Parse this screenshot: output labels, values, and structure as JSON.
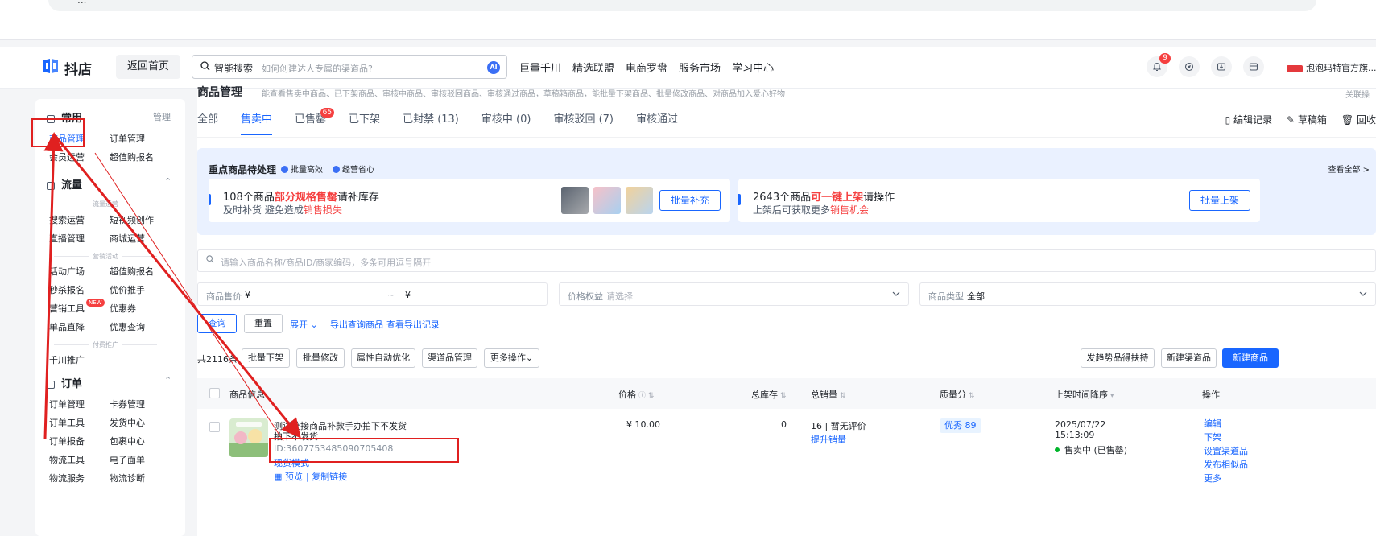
{
  "browser": {
    "url": "..."
  },
  "header": {
    "logo_text": "抖店",
    "home_button": "返回首页",
    "search_label": "智能搜索",
    "search_placeholder": "如何创建达人专属的渠道品?",
    "search_ai": "AI",
    "nav": [
      "巨量千川",
      "精选联盟",
      "电商罗盘",
      "服务市场",
      "学习中心"
    ],
    "notification_count": "9",
    "shop_name": "泡泡玛特官方旗..."
  },
  "sidebar": {
    "common": {
      "title": "常用",
      "manage": "管理",
      "items": [
        "商品管理",
        "订单管理",
        "会员运营",
        "超值购报名"
      ]
    },
    "traffic": {
      "title": "流量",
      "group1": "流量运营",
      "group1_items": [
        "搜索运营",
        "短视频创作",
        "直播管理",
        "商城运营"
      ],
      "group2": "营销活动",
      "group2_items": [
        "活动广场",
        "超值购报名",
        "秒杀报名",
        "优价推手",
        "营销工具",
        "优惠券",
        "单品直降",
        "优惠查询"
      ],
      "new_badge": "NEW",
      "group3": "付费推广",
      "group3_items": [
        "千川推广"
      ]
    },
    "orders": {
      "title": "订单",
      "items": [
        "订单管理",
        "卡券管理",
        "订单工具",
        "发货中心",
        "订单报备",
        "包裹中心",
        "物流工具",
        "电子面单",
        "物流服务",
        "物流诊断"
      ]
    }
  },
  "main": {
    "title": "商品管理",
    "description": "能查看售卖中商品、已下架商品、审核中商品、审核驳回商品、审核通过商品，草稿箱商品，能批量下架商品、批量修改商品、对商品加入爱心好物",
    "top_right": "关联操",
    "tabs": [
      {
        "label": "全部"
      },
      {
        "label": "售卖中",
        "active": true
      },
      {
        "label": "已售罄",
        "badge": "65"
      },
      {
        "label": "已下架"
      },
      {
        "label": "已封禁 (13)"
      },
      {
        "label": "审核中 (0)"
      },
      {
        "label": "审核驳回 (7)"
      },
      {
        "label": "审核通过"
      }
    ],
    "tab_tools": [
      "编辑记录",
      "草稿箱",
      "回收"
    ],
    "focus": {
      "title": "重点商品待处理",
      "chip1": "批量高效",
      "chip2": "经营省心",
      "view_all": "查看全部 >",
      "card1": {
        "l1_a": "108个商品",
        "l1_b": "部分规格售罄",
        "l1_c": "请补库存",
        "l2_a": "及时补货 避免造成",
        "l2_b": "销售损失",
        "button": "批量补充"
      },
      "card2": {
        "l1_a": "2643个商品",
        "l1_b": "可一键上架",
        "l1_c": "请操作",
        "l2_a": "上架后可获取更多",
        "l2_b": "销售机会",
        "button": "批量上架"
      }
    },
    "query_placeholder": "请输入商品名称/商品ID/商家编码，多条可用逗号隔开",
    "filters": {
      "price_label": "商品售价",
      "price_from": "¥",
      "price_sep": "~",
      "price_to": "¥",
      "rights_label": "价格权益",
      "rights_placeholder": "请选择",
      "type_label": "商品类型",
      "type_value": "全部"
    },
    "actions": {
      "query": "查询",
      "reset": "重置",
      "expand": "展开",
      "export": "导出查询商品",
      "export_log": "查看导出记录"
    },
    "list_bar": {
      "count": "共2116条",
      "buttons": [
        "批量下架",
        "批量修改",
        "属性自动优化",
        "渠道品管理",
        "更多操作"
      ],
      "right_buttons": [
        "发趋势品得扶持",
        "新建渠道品"
      ],
      "create": "新建商品"
    },
    "table": {
      "headers": [
        "商品信息",
        "价格",
        "总库存",
        "总销量",
        "质量分",
        "上架时间降序",
        "操作"
      ],
      "row": {
        "title_l1": "测试链接商品补款手办拍下不发货",
        "title_l2": "拍下不发货",
        "id": "ID:3607753485090705408",
        "mode": "现货模式",
        "preview": "预览",
        "copy_link": "复制链接",
        "price": "¥ 10.00",
        "stock": "0",
        "sales": "16",
        "sales_note": "暂无评价",
        "boost": "提升销量",
        "quality": "优秀 89",
        "date": "2025/07/22",
        "time": "15:13:09",
        "status": "售卖中 (已售罄)",
        "ops": [
          "编辑",
          "下架",
          "设置渠道品",
          "发布相似品",
          "更多"
        ]
      }
    }
  },
  "colors": {
    "brand": "#1966ff",
    "alert": "#f53f3f",
    "annotation": "#e02020"
  }
}
